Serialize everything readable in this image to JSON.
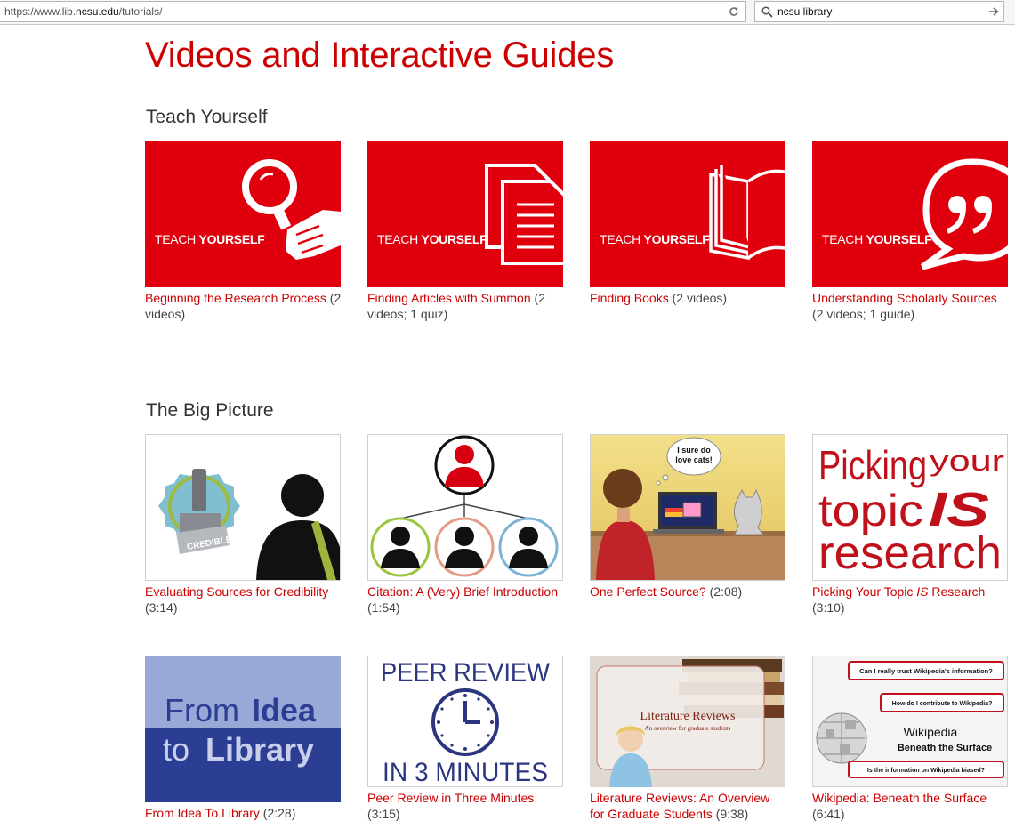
{
  "browser": {
    "url_prefix": "https://www.lib.",
    "url_domain": "ncsu.edu",
    "url_suffix": "/tutorials/",
    "search_query": "ncsu library"
  },
  "page": {
    "title": "Videos and Interactive Guides"
  },
  "sections": [
    {
      "title": "Teach Yourself",
      "items": [
        {
          "thumb_label_regular": "TEACH ",
          "thumb_label_bold": "YOURSELF",
          "link": "Beginning the Research Process",
          "meta": " (2 videos)"
        },
        {
          "thumb_label_regular": "TEACH ",
          "thumb_label_bold": "YOURSELF",
          "link": "Finding Articles with Summon",
          "meta": " (2 videos; 1 quiz)"
        },
        {
          "thumb_label_regular": "TEACH ",
          "thumb_label_bold": "YOURSELF",
          "link": "Finding Books",
          "meta": " (2 videos)"
        },
        {
          "thumb_label_regular": "TEACH ",
          "thumb_label_bold": "YOURSELF",
          "link": "Understanding Scholarly Sources",
          "meta": " (2 videos; 1 guide)"
        }
      ]
    },
    {
      "title": "The Big Picture",
      "items": [
        {
          "thumb_text": "CREDIBLE",
          "link": "Evaluating Sources for Credibility",
          "meta": " (3:14)"
        },
        {
          "link": "Citation: A (Very) Brief Introduction",
          "meta": " (1:54)"
        },
        {
          "thumb_text_1": "I sure do",
          "thumb_text_2": "love cats!",
          "link": "One Perfect Source?",
          "meta": " (2:08)"
        },
        {
          "thumb_line_1a": "Picking",
          "thumb_line_1b": "your",
          "thumb_line_2a": "topic",
          "thumb_line_2b": "IS",
          "thumb_line_3": "research",
          "link_pre": "Picking Your Topic ",
          "link_em": "IS",
          "link_post": " Research",
          "meta": " (3:10)"
        }
      ]
    },
    {
      "items": [
        {
          "thumb_line_1a": "From ",
          "thumb_line_1b": "Idea",
          "thumb_line_2a": "to ",
          "thumb_line_2b": "Library",
          "link": "From Idea To Library",
          "meta": " (2:28)"
        },
        {
          "thumb_line_1": "PEER REVIEW",
          "thumb_line_2": "IN 3 MINUTES",
          "link": "Peer Review in Three Minutes",
          "meta": " (3:15)"
        },
        {
          "thumb_title": "Literature Reviews",
          "thumb_subtitle": "An overview for graduate students",
          "link": "Literature Reviews: An Overview for Graduate Students",
          "meta": " (9:38)"
        },
        {
          "thumb_q1": "Can I really trust Wikipedia's information?",
          "thumb_q2": "How do I contribute to Wikipedia?",
          "thumb_q3": "Is the information on Wikipedia biased?",
          "thumb_title": "Wikipedia",
          "thumb_subtitle": "Beneath the Surface",
          "link": "Wikipedia: Beneath the Surface",
          "meta": " (6:41)"
        }
      ]
    }
  ],
  "colors": {
    "brand_red": "#cc0000",
    "thumb_red": "#e0000d",
    "link_red": "#cc0000"
  },
  "icons": [
    "refresh-icon",
    "search-icon",
    "arrow-right-icon",
    "magnifier-hand-icon",
    "documents-icon",
    "open-book-icon",
    "quote-bubble-icon",
    "clock-icon",
    "wikipedia-globe-icon"
  ]
}
